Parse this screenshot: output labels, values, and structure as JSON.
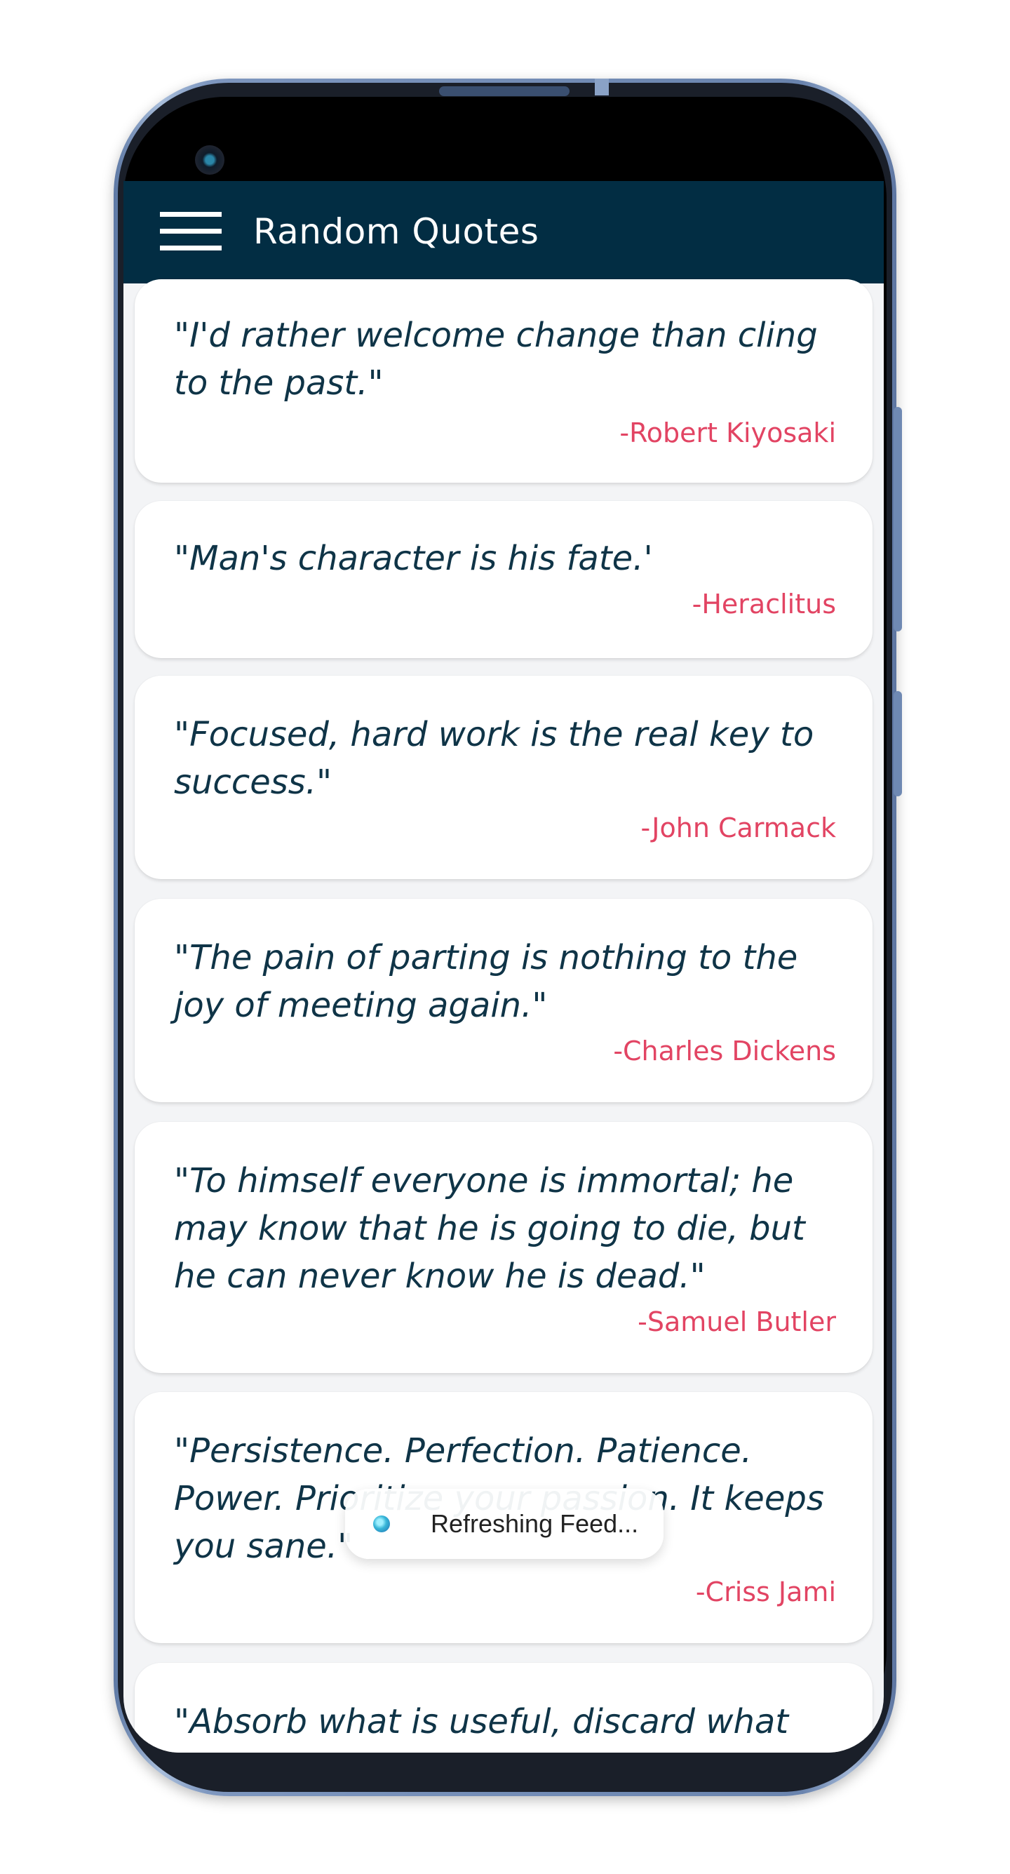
{
  "app": {
    "title": "Random Quotes"
  },
  "icons": {
    "menu": "hamburger-menu-icon",
    "toast": "app-icon"
  },
  "colors": {
    "appbar": "#022d43",
    "quote_text": "#0f3447",
    "author_text": "#e24463",
    "background": "#f3f4f6"
  },
  "quotes": [
    {
      "text": "\"I'd rather welcome change than cling to the past.\"",
      "author": "-Robert Kiyosaki"
    },
    {
      "text": "\"Man's character is his fate.'",
      "author": "-Heraclitus"
    },
    {
      "text": "\"Focused, hard work is the real key to success.\"",
      "author": "-John Carmack"
    },
    {
      "text": "\"The pain of parting is nothing to the joy of meeting again.\"",
      "author": "-Charles Dickens"
    },
    {
      "text": "\"To himself everyone is immortal; he may know that he is going to die, but he can never know he is dead.\"",
      "author": "-Samuel Butler"
    },
    {
      "text": "\"Persistence. Perfection. Patience. Power. Prioritize your passion. It keeps you sane.\"",
      "author": "-Criss Jami"
    },
    {
      "text": "\"Absorb what is useful, discard what",
      "author": ""
    }
  ],
  "toast": {
    "message": "Refreshing Feed..."
  }
}
